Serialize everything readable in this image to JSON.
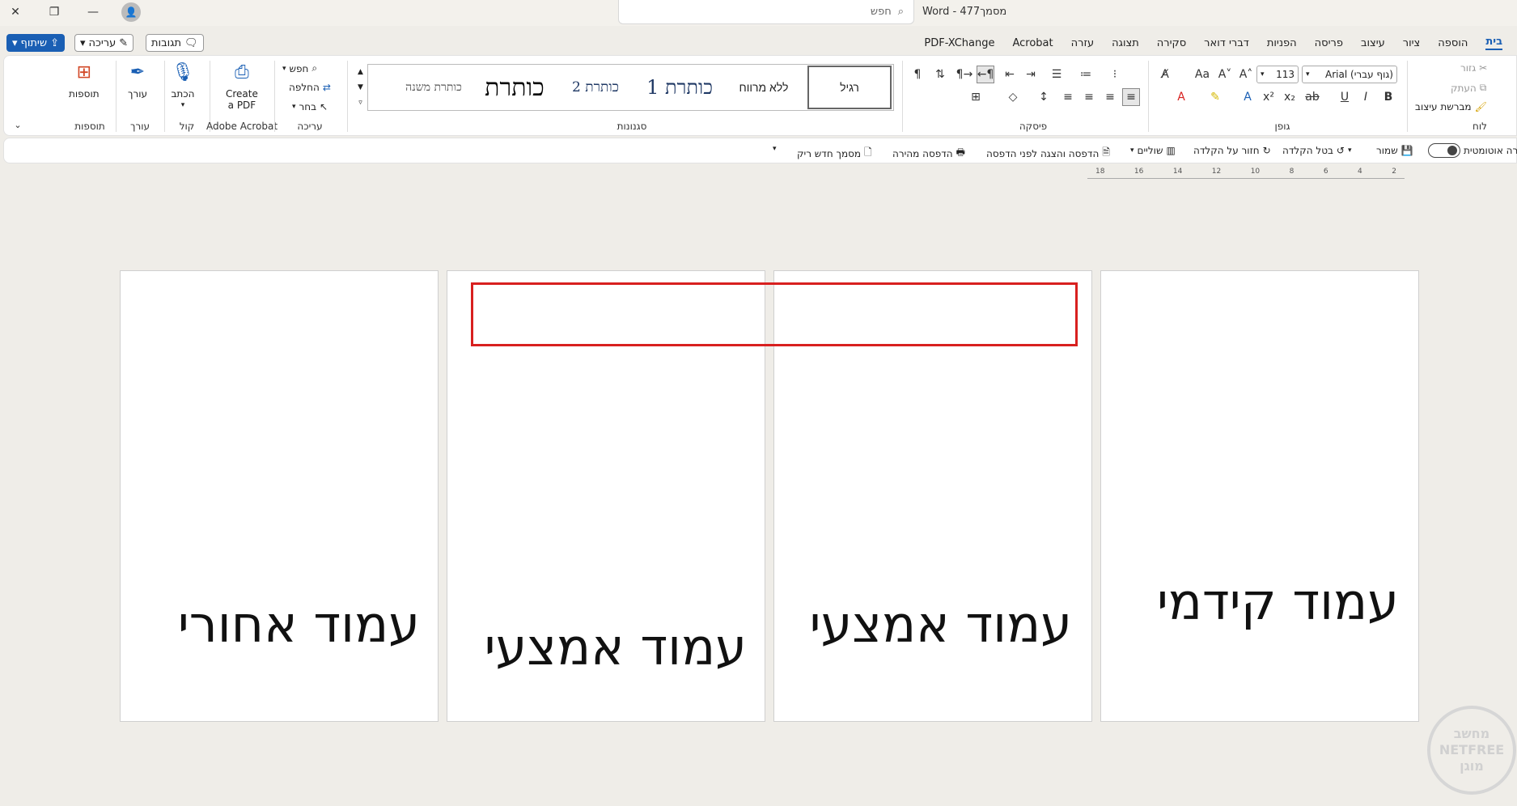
{
  "window": {
    "title": "Word - 477מסמך",
    "search_placeholder": "חפש",
    "close": "✕",
    "restore": "❐",
    "minimize": "—"
  },
  "top_buttons": {
    "share": "שיתוף",
    "edit": "עריכה",
    "comments": "תגובות"
  },
  "tabs": [
    "בית",
    "הוספה",
    "ציור",
    "עיצוב",
    "פריסה",
    "הפניות",
    "דברי דואר",
    "סקירה",
    "תצוגה",
    "עזרה",
    "Acrobat",
    "PDF-XChange"
  ],
  "ribbon": {
    "groups": {
      "addins": "תוספות",
      "editor": "עורך",
      "voice": "קול",
      "acrobat": "Adobe Acrobat",
      "editing": "עריכה",
      "styles": "סגנונות",
      "paragraph": "פיסקה",
      "font": "גופן",
      "clipboard": "לוח"
    },
    "addins_btn": "תוספות",
    "editor_btn": "עורך",
    "dictate_btn": "הכתב",
    "create_pdf_l1": "Create",
    "create_pdf_l2": "a PDF",
    "find": "חפש",
    "replace": "החלפה",
    "select": "בחר",
    "styles": [
      "רגיל",
      "ללא מרווח",
      "כותרת 1",
      "כותרת 2",
      "כותרת",
      "כותרת משנה"
    ],
    "font_name": "(גוף עברי) Arial",
    "font_size": "113",
    "cut": "גזור",
    "copy": "העתק",
    "format_painter": "מברשת עיצוב"
  },
  "qat": {
    "autosave": "שמירה אוטומטית",
    "save": "שמור",
    "undo": "בטל הקלדה",
    "redo": "חזור על הקלדה",
    "margins": "שוליים",
    "print_preview": "הדפסה והצגה לפני הדפסה",
    "quick_print": "הדפסה מהירה",
    "new_doc": "מסמך חדש ריק"
  },
  "ruler_ticks": [
    "2",
    "4",
    "6",
    "8",
    "10",
    "12",
    "14",
    "16",
    "18"
  ],
  "pages": {
    "back": "עמוד אחורי",
    "middle_left": "עמוד אמצעי",
    "middle_right": "עמוד אמצעי",
    "front": "עמוד קידמי"
  },
  "watermark": {
    "line1": "מחשב",
    "line2": "NETFREE",
    "line3": "מוגן"
  }
}
